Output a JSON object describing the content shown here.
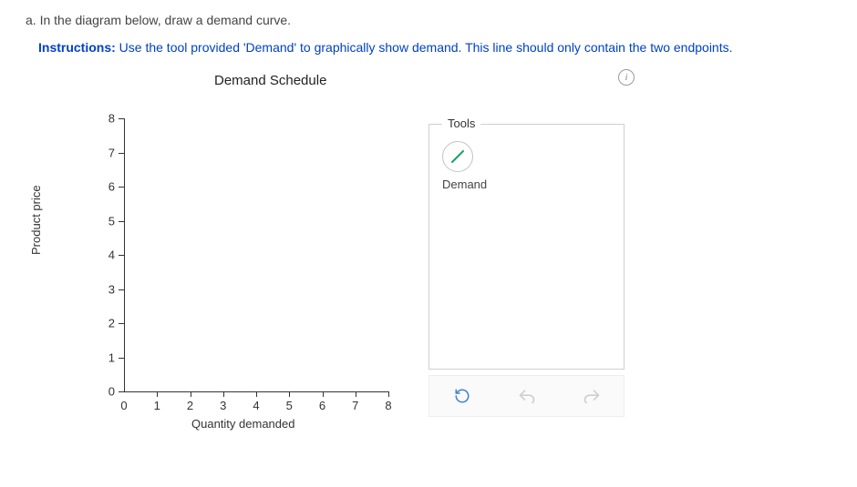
{
  "question": {
    "prefix": "a.",
    "text": "In the diagram below, draw a demand curve."
  },
  "instructions": {
    "label": "Instructions:",
    "body": "Use the tool provided 'Demand' to graphically show demand. This line should only contain the two endpoints."
  },
  "chart_data": {
    "type": "line",
    "title": "Demand Schedule",
    "xlabel": "Quantity demanded",
    "ylabel": "Product price",
    "xlim": [
      0,
      8
    ],
    "ylim": [
      0,
      8
    ],
    "x_ticks": [
      0,
      1,
      2,
      3,
      4,
      5,
      6,
      7,
      8
    ],
    "y_ticks": [
      0,
      1,
      2,
      3,
      4,
      5,
      6,
      7,
      8
    ],
    "series": [],
    "grid": false
  },
  "tools_panel": {
    "legend": "Tools",
    "items": [
      {
        "name": "demand",
        "label": "Demand"
      }
    ]
  },
  "info_icon": "i",
  "actions": {
    "reset": "reset",
    "undo": "undo",
    "redo": "redo"
  }
}
